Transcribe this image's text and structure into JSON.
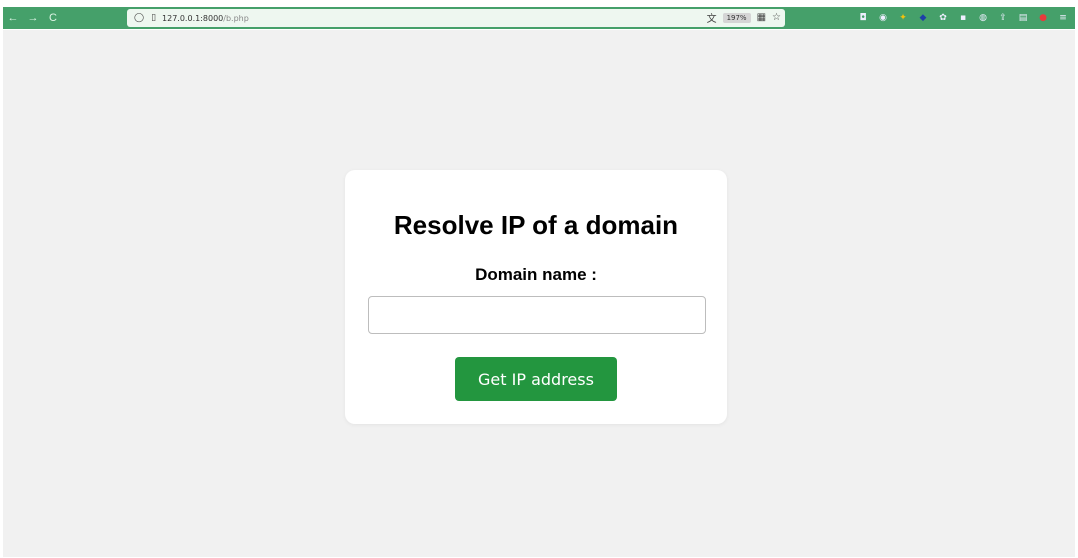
{
  "browser": {
    "nav": {
      "back": "←",
      "forward": "→",
      "reload": "C"
    },
    "url_host": "127.0.0.1:8000",
    "url_path": "/b.php",
    "zoom": "197%",
    "toolbar_color": "#45a06a",
    "extension_icons": [
      "pocket-icon",
      "account-icon",
      "buy-extension-icon",
      "blue-extension-icon",
      "extension-icon",
      "grid-extension-icon",
      "extension-icon-2",
      "share-icon",
      "reader-icon",
      "ublock-icon",
      "menu-icon"
    ]
  },
  "page": {
    "background": "#f1f1f1",
    "title": "Resolve IP of a domain",
    "domain_label": "Domain name :",
    "domain_value": "",
    "button_label": "Get IP address",
    "button_color": "#23963f"
  }
}
